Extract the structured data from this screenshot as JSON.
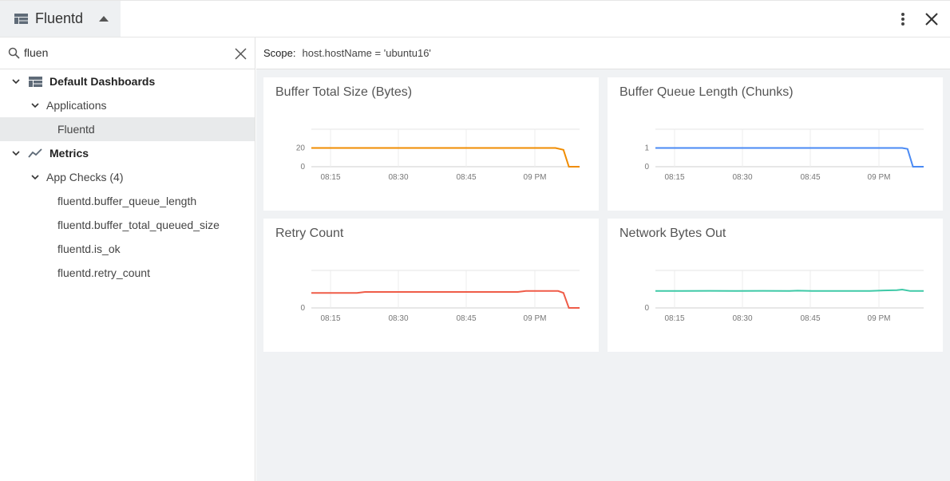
{
  "header": {
    "title": "Fluentd"
  },
  "sidebar": {
    "search": {
      "value": "fluen"
    },
    "tree": {
      "default_dashboards": "Default Dashboards",
      "applications": "Applications",
      "fluentd": "Fluentd",
      "metrics": "Metrics",
      "app_checks": "App Checks (4)",
      "checks": [
        "fluentd.buffer_queue_length",
        "fluentd.buffer_total_queued_size",
        "fluentd.is_ok",
        "fluentd.retry_count"
      ]
    }
  },
  "scope": {
    "label": "Scope:",
    "value": "host.hostName = 'ubuntu16'"
  },
  "colors": {
    "orange": "#f08c00",
    "blue": "#4a8af4",
    "red": "#ef5c48",
    "teal": "#3ec9a7"
  },
  "chart_data": [
    {
      "type": "line",
      "title": "Buffer Total Size (Bytes)",
      "x_ticks": [
        "08:15",
        "08:30",
        "08:45",
        "09 PM"
      ],
      "y_ticks": [
        "0",
        "20"
      ],
      "ylim": [
        0,
        40
      ],
      "series": [
        {
          "color": "#f08c00",
          "x": [
            0,
            0.3,
            0.6,
            0.9,
            0.91,
            0.94,
            0.96,
            1
          ],
          "y": [
            20,
            20,
            20,
            20,
            20,
            18,
            0,
            0
          ]
        }
      ]
    },
    {
      "type": "line",
      "title": "Buffer Queue Length (Chunks)",
      "x_ticks": [
        "08:15",
        "08:30",
        "08:45",
        "09 PM"
      ],
      "y_ticks": [
        "0",
        "1"
      ],
      "ylim": [
        0,
        2
      ],
      "series": [
        {
          "color": "#4a8af4",
          "x": [
            0,
            0.3,
            0.6,
            0.92,
            0.94,
            0.96,
            1
          ],
          "y": [
            1,
            1,
            1,
            1,
            0.95,
            0,
            0
          ]
        }
      ]
    },
    {
      "type": "line",
      "title": "Retry Count",
      "x_ticks": [
        "08:15",
        "08:30",
        "08:45",
        "09 PM"
      ],
      "y_ticks": [
        "0"
      ],
      "ylim": [
        0,
        2
      ],
      "series": [
        {
          "color": "#ef5c48",
          "x": [
            0,
            0.17,
            0.2,
            0.55,
            0.77,
            0.8,
            0.92,
            0.94,
            0.96,
            1
          ],
          "y": [
            0.8,
            0.8,
            0.85,
            0.85,
            0.85,
            0.9,
            0.9,
            0.8,
            0,
            0
          ]
        }
      ]
    },
    {
      "type": "line",
      "title": "Network Bytes Out",
      "x_ticks": [
        "08:15",
        "08:30",
        "08:45",
        "09 PM"
      ],
      "y_ticks": [
        "0"
      ],
      "ylim": [
        0,
        2
      ],
      "series": [
        {
          "color": "#3ec9a7",
          "x": [
            0,
            0.1,
            0.2,
            0.3,
            0.4,
            0.5,
            0.53,
            0.6,
            0.7,
            0.8,
            0.85,
            0.9,
            0.92,
            0.95,
            1
          ],
          "y": [
            0.9,
            0.9,
            0.91,
            0.9,
            0.91,
            0.9,
            0.92,
            0.9,
            0.9,
            0.9,
            0.93,
            0.95,
            0.98,
            0.9,
            0.9
          ]
        }
      ]
    }
  ]
}
